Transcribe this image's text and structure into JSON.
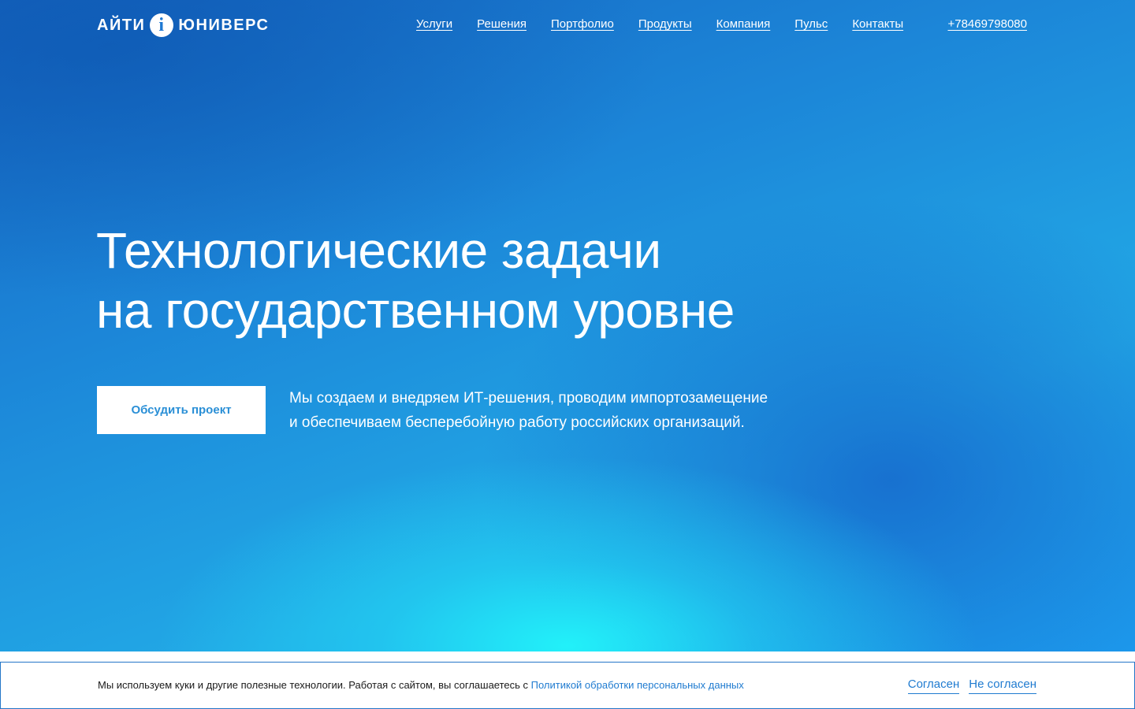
{
  "header": {
    "logo_left": "АЙТИ",
    "logo_mark": "i",
    "logo_right": "ЮНИВЕРС",
    "nav": [
      {
        "label": "Услуги"
      },
      {
        "label": "Решения"
      },
      {
        "label": "Портфолио"
      },
      {
        "label": "Продукты"
      },
      {
        "label": "Компания"
      },
      {
        "label": "Пульс"
      },
      {
        "label": "Контакты"
      }
    ],
    "phone": "+78469798080"
  },
  "hero": {
    "title_line1": "Технологические задачи",
    "title_line2": "на государственном уровне",
    "cta_label": "Обсудить проект",
    "lead_line1": "Мы создаем и внедряем ИТ-решения, проводим импортозамещение",
    "lead_line2": "и обеспечиваем бесперебойную работу российских организаций."
  },
  "cookie": {
    "text": "Мы используем куки и другие полезные технологии. Работая с сайтом, вы соглашаетесь с ",
    "policy_link": "Политикой обработки персональных данных",
    "accept": "Согласен",
    "decline": "Не согласен"
  },
  "colors": {
    "accent": "#1f7bd0",
    "hero_blue": "#1c86d8",
    "hero_cyan": "#22f5fa"
  }
}
